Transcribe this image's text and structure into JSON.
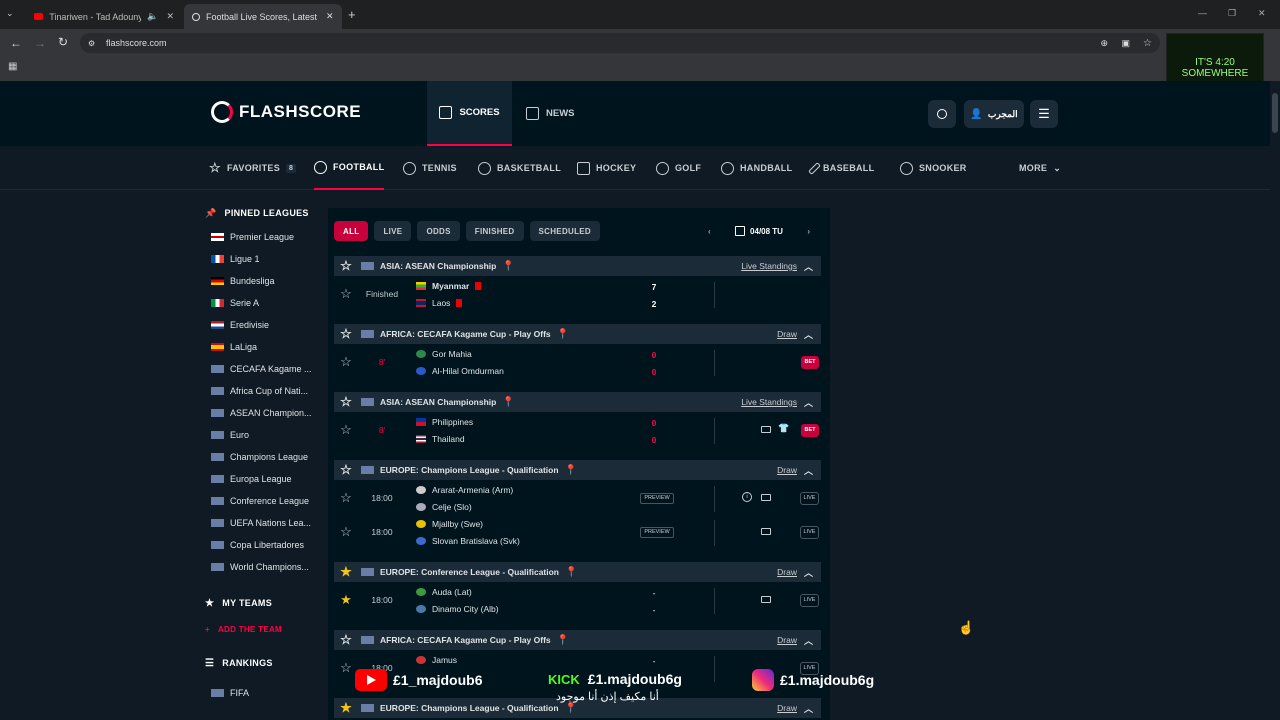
{
  "browser": {
    "tabs": [
      {
        "title": "Tinariwen - Tad Adounya -"
      },
      {
        "title": "Football Live Scores, Latest Foo"
      }
    ],
    "url": "flashscore.com"
  },
  "header": {
    "logo": "FLASHSCORE",
    "nav": [
      {
        "label": "SCORES"
      },
      {
        "label": "NEWS"
      }
    ],
    "user_label": "المجرب"
  },
  "sports": {
    "favorites": "FAVORITES",
    "favorites_count": "8",
    "items": [
      "FOOTBALL",
      "TENNIS",
      "BASKETBALL",
      "HOCKEY",
      "GOLF",
      "HANDBALL",
      "BASEBALL",
      "SNOOKER"
    ],
    "more": "MORE"
  },
  "sidebar": {
    "pinned_title": "PINNED LEAGUES",
    "leagues": [
      "Premier League",
      "Ligue 1",
      "Bundesliga",
      "Serie A",
      "Eredivisie",
      "LaLiga",
      "CECAFA Kagame ...",
      "Africa Cup of Nati...",
      "ASEAN Champion...",
      "Euro",
      "Champions League",
      "Europa League",
      "Conference League",
      "UEFA Nations Lea...",
      "Copa Libertadores",
      "World Champions..."
    ],
    "my_teams": "MY TEAMS",
    "add_team": "ADD THE TEAM",
    "rankings": "RANKINGS",
    "fifa": "FIFA"
  },
  "filters": {
    "items": [
      "ALL",
      "LIVE",
      "ODDS",
      "FINISHED",
      "SCHEDULED"
    ],
    "date": "04/08 TU"
  },
  "leagues": [
    {
      "name": "ASIA: ASEAN Championship",
      "link": "Live Standings"
    },
    {
      "name": "AFRICA: CECAFA Kagame Cup - Play Offs",
      "link": "Draw"
    },
    {
      "name": "ASIA: ASEAN Championship",
      "link": "Live Standings"
    },
    {
      "name": "EUROPE: Champions League - Qualification",
      "link": "Draw"
    },
    {
      "name": "EUROPE: Conference League - Qualification",
      "link": "Draw"
    },
    {
      "name": "AFRICA: CECAFA Kagame Cup - Play Offs",
      "link": "Draw"
    },
    {
      "name": "EUROPE: Champions League - Qualification",
      "link": "Draw"
    }
  ],
  "matches": [
    {
      "status": "Finished",
      "home": "Myanmar",
      "away": "Laos",
      "hs": "7",
      "as": "2"
    },
    {
      "status": "8'",
      "home": "Gor Mahia",
      "away": "Al-Hilal Omdurman",
      "hs": "0",
      "as": "0"
    },
    {
      "status": "8'",
      "home": "Philippines",
      "away": "Thailand",
      "hs": "0",
      "as": "0"
    },
    {
      "status": "18:00",
      "home": "Ararat-Armenia (Arm)",
      "away": "Celje (Slo)",
      "badge": "PREVIEW"
    },
    {
      "status": "18:00",
      "home": "Mjallby (Swe)",
      "away": "Slovan Bratislava (Svk)",
      "badge": "PREVIEW"
    },
    {
      "status": "18:00",
      "home": "Auda (Lat)",
      "away": "Dinamo City (Alb)",
      "hs": "-",
      "as": "-"
    },
    {
      "status": "18:00",
      "home": "Jamus",
      "away": "",
      "hs": "-",
      "as": ""
    }
  ],
  "labels": {
    "bet": "BET",
    "live": "LIVE"
  },
  "overlay": {
    "yt": "£1_majdoub6",
    "kick_brand": "KICK",
    "kick": "£1.majdoub6g",
    "ig": "£1.majdoub6g",
    "arabic": "أنا مكيف إذن أنا موجود",
    "tv_text": "IT'S 4:20 SOMEWHERE"
  },
  "colors": {
    "accent": "#ff0046",
    "bg": "#0f1a24",
    "header": "#00141e"
  }
}
